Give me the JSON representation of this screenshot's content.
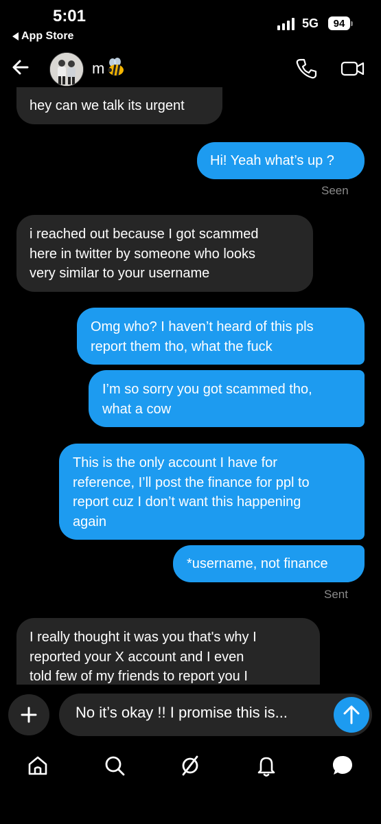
{
  "status_bar": {
    "time": "5:01",
    "back_app": "App Store",
    "network": "5G",
    "battery": "94"
  },
  "header": {
    "contact_name": "m",
    "contact_emoji": "bee-icon",
    "icons": [
      "back-arrow-icon",
      "phone-icon",
      "video-camera-icon"
    ]
  },
  "messages": [
    {
      "from": "them",
      "lines": [
        "hey can we talk its urgent"
      ]
    },
    {
      "from": "me",
      "lines": [
        "Hi! Yeah what’s up ?"
      ]
    },
    {
      "status": "Seen"
    },
    {
      "from": "them",
      "lines": [
        "i reached out because I got scammed",
        "here in twitter by someone who looks",
        "very similar to your username"
      ]
    },
    {
      "from": "me",
      "lines": [
        "Omg who? I haven’t heard of this pls",
        "report them tho, what the fuck"
      ]
    },
    {
      "from": "me",
      "lines": [
        "I’m so sorry you got scammed tho,",
        "what a cow"
      ]
    },
    {
      "from": "me",
      "lines": [
        "This is the only account I have for",
        "reference, I’ll post the finance for ppl to",
        "report cuz I don’t want this happening",
        "again"
      ]
    },
    {
      "from": "me",
      "lines": [
        "*username, not finance"
      ]
    },
    {
      "status": "Sent"
    },
    {
      "from": "them",
      "lines": [
        "I really thought it was you that's why I",
        "reported your X account and I even",
        "told few of my friends to report you I"
      ]
    }
  ],
  "composer": {
    "draft_text": "No it’s okay !! I promise this is...",
    "icons": [
      "plus-icon",
      "send-arrow-icon"
    ]
  },
  "bottom_nav": [
    "home-icon",
    "search-icon",
    "slashed-circle-icon",
    "bell-icon",
    "messages-icon"
  ],
  "colors": {
    "background": "#000000",
    "incoming_bubble": "#262626",
    "outgoing_bubble": "#1d9bf0",
    "meta_text": "#8a8a8a"
  }
}
